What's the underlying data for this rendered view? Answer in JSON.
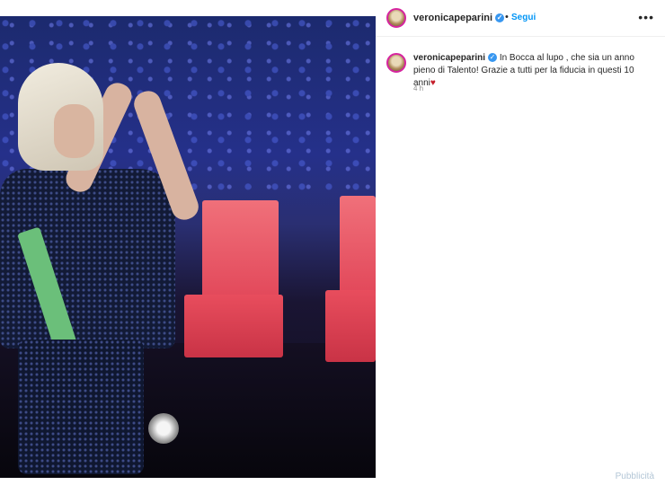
{
  "post": {
    "image_alt": "",
    "header": {
      "username": "veronicapeparini",
      "separator": "•",
      "follow_label": "Segui",
      "more_icon": "more-options-icon"
    },
    "caption": {
      "username": "veronicapeparini",
      "text": "In Bocca al lupo , che sia un anno pieno di Talento! Grazie a tutti per la fiducia in questi 10 anni",
      "emoji": "♥"
    },
    "timestamp": "4 h",
    "verified_icon": "verified-badge-icon"
  },
  "footer": {
    "watermark": "Pubblicità"
  },
  "colors": {
    "link": "#0095f6",
    "verified": "#3897f0",
    "heart": "#c41e2a",
    "avatar_ring": "#d6249f"
  }
}
